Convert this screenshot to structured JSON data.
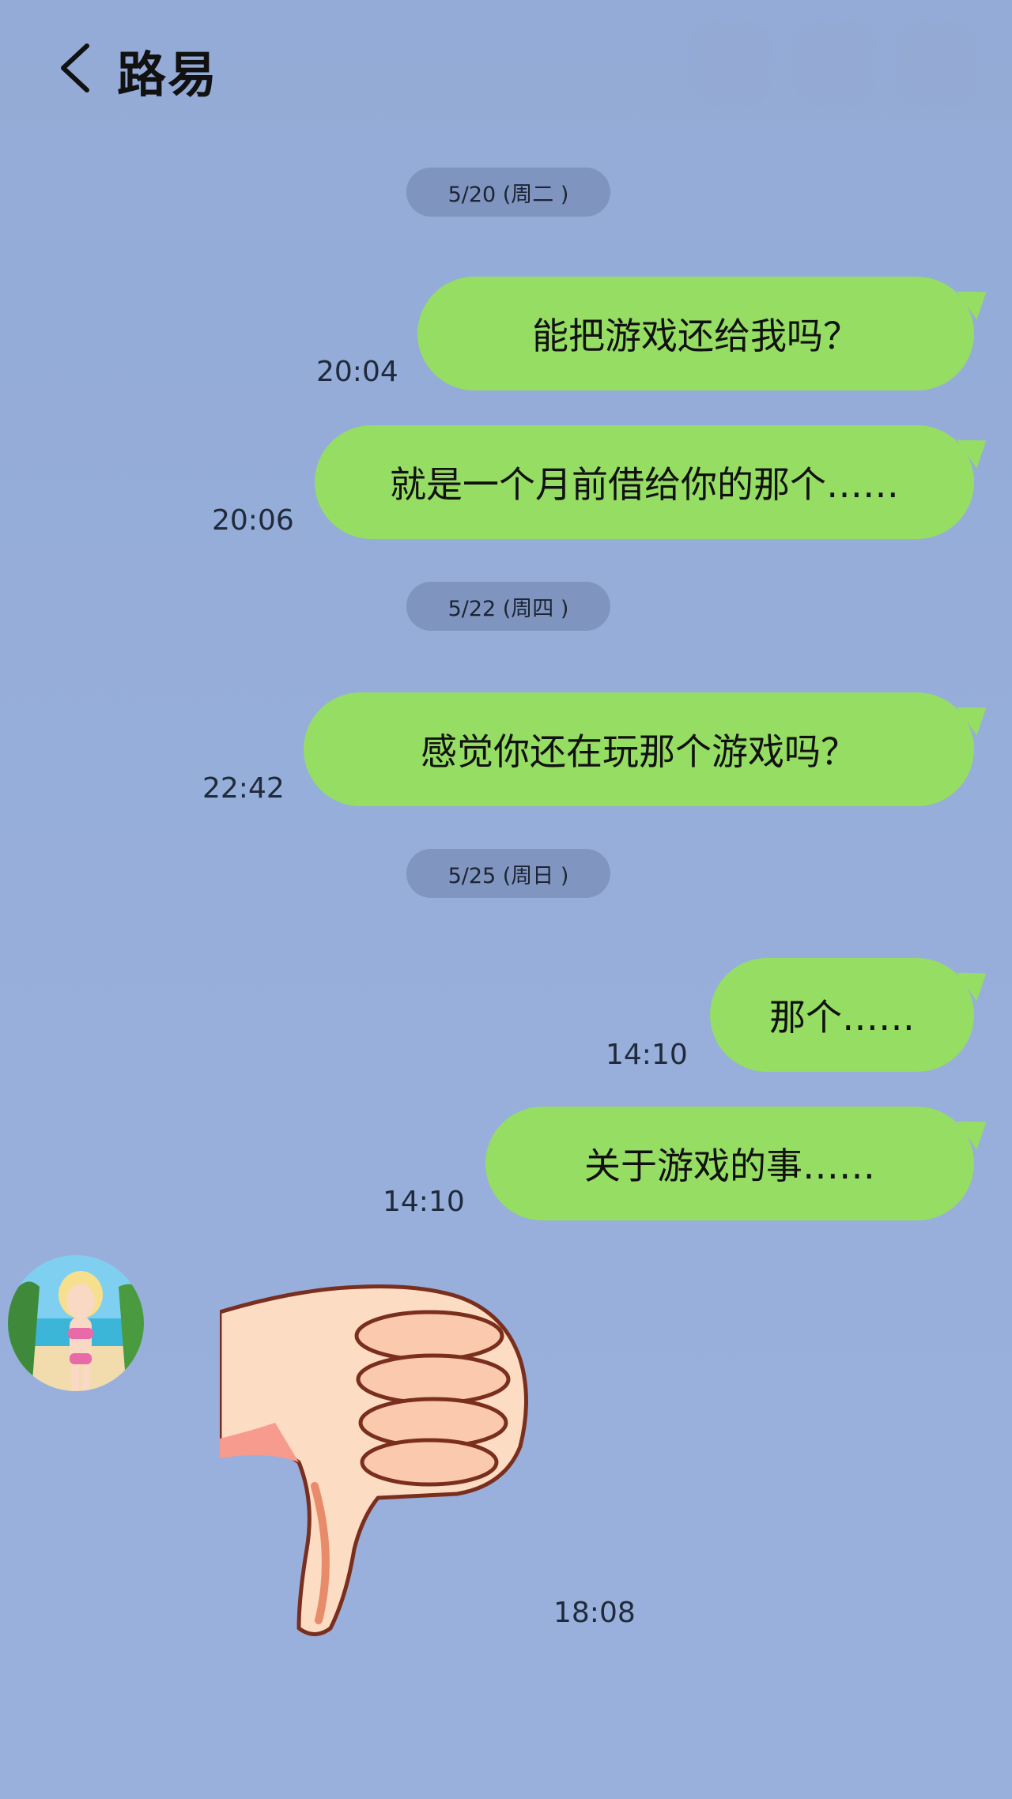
{
  "header": {
    "title": "路易",
    "back_icon": "chevron-left-icon"
  },
  "dates": [
    "5/20 (周二 )",
    "5/22 (周四 )",
    "5/25 (周日 )"
  ],
  "messages": [
    {
      "text": "能把游戏还给我吗？",
      "time": "20:04"
    },
    {
      "text": "就是一个月前借给你的那个……",
      "time": "20:06"
    },
    {
      "text": "感觉你还在玩那个游戏吗？",
      "time": "22:42"
    },
    {
      "text": "那个……",
      "time": "14:10"
    },
    {
      "text": "关于游戏的事……",
      "time": "14:10"
    }
  ],
  "incoming": {
    "sticker": "thumbs-down-icon",
    "time": "18:08"
  },
  "colors": {
    "background": "#97aedb",
    "bubble": "#96dd63"
  }
}
